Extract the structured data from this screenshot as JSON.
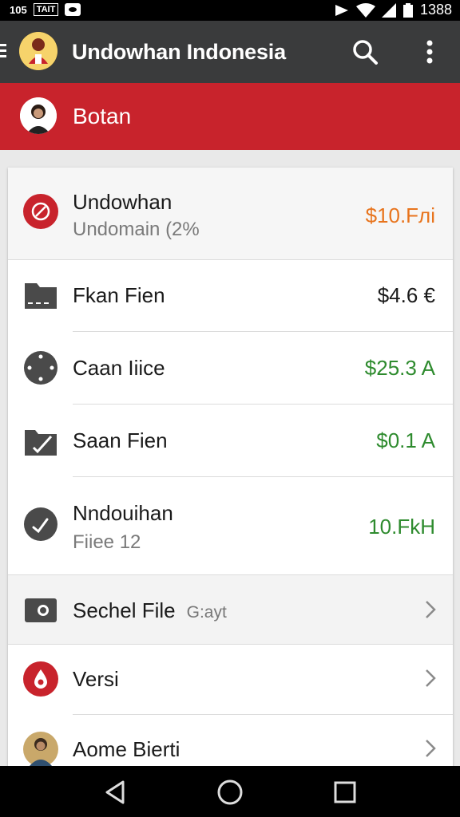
{
  "status_bar": {
    "left_text": "105",
    "chip_text": "TAIT",
    "time": "1388"
  },
  "app_bar": {
    "title": "Undowhan Indonesia"
  },
  "sub_header": {
    "title": "Botan"
  },
  "list": [
    {
      "title": "Undowhan",
      "subtitle": "Undomain (2%",
      "value": "$10.Fлi",
      "value_color": "#e8741d",
      "icon": "red-emblem-icon"
    },
    {
      "title": "Fkan Fien",
      "value": "$4.6 €",
      "value_color": "#1a1a1a",
      "icon": "folder-icon"
    },
    {
      "title": "Caan Iiice",
      "value": "$25.3 A",
      "value_color": "#2e8b2e",
      "icon": "compass-icon"
    },
    {
      "title": "Saan Fien",
      "value": "$0.1 A",
      "value_color": "#2e8b2e",
      "icon": "edit-folder-icon"
    },
    {
      "title": "Nndouihan",
      "subtitle": "Fiiee 12",
      "value": "10.FkH",
      "value_color": "#2e8b2e",
      "icon": "check-circle-icon"
    }
  ],
  "settings": [
    {
      "title": "Sechel File",
      "inline_note": "G:ayt",
      "icon": "camera-icon"
    },
    {
      "title": "Versi",
      "icon": "drop-icon"
    },
    {
      "title": "Aome Bierti",
      "icon": "profile-avatar-icon"
    }
  ],
  "colors": {
    "app_bar": "#3a3b3c",
    "accent_red": "#c8232c",
    "positive": "#2e8b2e",
    "highlight": "#e8741d"
  }
}
